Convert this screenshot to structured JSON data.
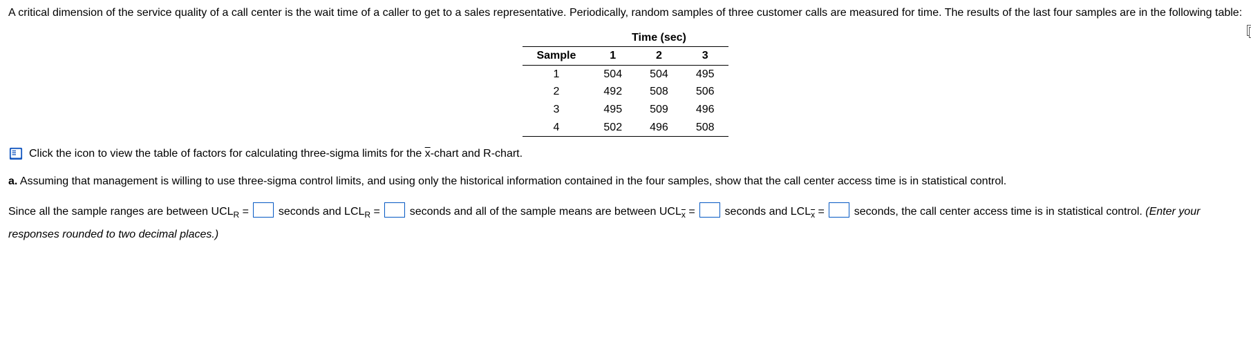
{
  "intro": "A critical dimension of the service quality of a call center is the wait time of a caller to get to a sales representative. Periodically, random samples of three customer calls are measured for time. The results of the last four samples are in the following table:",
  "table": {
    "time_header": "Time (sec)",
    "sample_header": "Sample",
    "col_headers": [
      "1",
      "2",
      "3"
    ],
    "rows": [
      {
        "sample": "1",
        "vals": [
          "504",
          "504",
          "495"
        ]
      },
      {
        "sample": "2",
        "vals": [
          "492",
          "508",
          "506"
        ]
      },
      {
        "sample": "3",
        "vals": [
          "495",
          "509",
          "496"
        ]
      },
      {
        "sample": "4",
        "vals": [
          "502",
          "496",
          "508"
        ]
      }
    ]
  },
  "link_text": "Click the icon to view the table of factors for calculating three-sigma limits for the ",
  "link_text_mid": "-chart and R-chart.",
  "xbar": "x",
  "qa_label": "a.",
  "qa_text": " Assuming that management is willing to use three-sigma control limits, and using only the historical information contained in the four samples, show that the call center access time is in statistical control.",
  "ans": {
    "p1": "Since all the sample ranges are between UCL",
    "sub_r": "R",
    "eq": " = ",
    "p2": " seconds and LCL",
    "p3": " seconds and all of the sample means are between UCL",
    "sub_x_html": "x̄",
    "p4": " seconds and LCL",
    "p5": " seconds, the call center access time is in statistical control. ",
    "hint": "(Enter your responses rounded to two decimal places.)"
  }
}
